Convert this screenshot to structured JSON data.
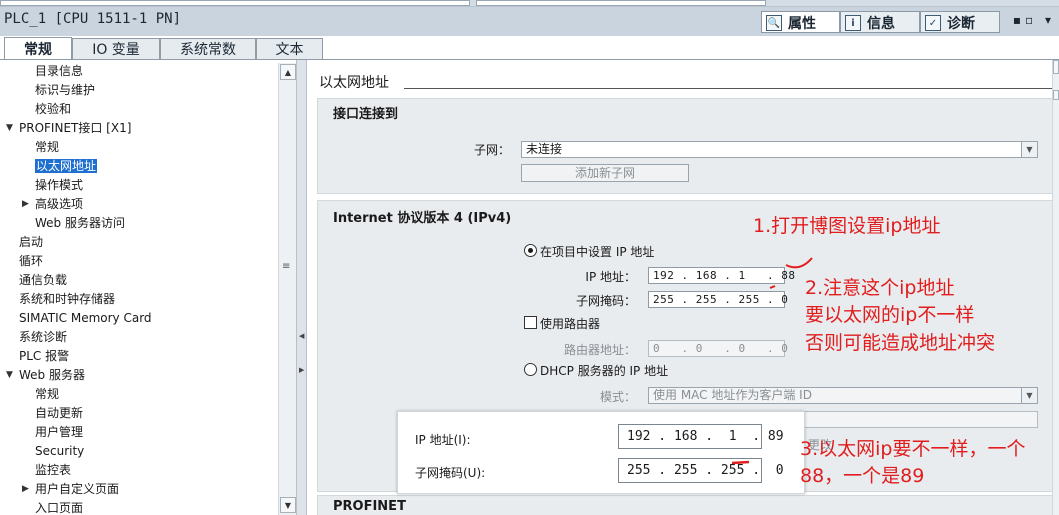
{
  "window": {
    "device_title": "PLC_1 [CPU 1511-1 PN]",
    "pane_tabs": [
      {
        "label": "属性",
        "icon": "properties-icon",
        "active": true
      },
      {
        "label": "信息",
        "icon": "info-icon",
        "active": false
      },
      {
        "label": "诊断",
        "icon": "diagnostics-icon",
        "active": false
      }
    ],
    "window_buttons": "▪▫ ▾"
  },
  "subtabs": [
    {
      "label": "常规",
      "active": true
    },
    {
      "label": "IO 变量",
      "active": false
    },
    {
      "label": "系统常数",
      "active": false
    },
    {
      "label": "文本",
      "active": false
    }
  ],
  "nav": {
    "items": [
      {
        "label": "目录信息",
        "level": 2,
        "arrow": ""
      },
      {
        "label": "标识与维护",
        "level": 2,
        "arrow": ""
      },
      {
        "label": "校验和",
        "level": 2,
        "arrow": ""
      },
      {
        "label": "PROFINET接口 [X1]",
        "level": 1,
        "arrow": "▼"
      },
      {
        "label": "常规",
        "level": 2,
        "arrow": ""
      },
      {
        "label": "以太网地址",
        "level": 2,
        "arrow": "",
        "selected": true
      },
      {
        "label": "操作模式",
        "level": 2,
        "arrow": ""
      },
      {
        "label": "高级选项",
        "level": 2,
        "arrow": "▶"
      },
      {
        "label": "Web 服务器访问",
        "level": 2,
        "arrow": ""
      },
      {
        "label": "启动",
        "level": 1,
        "arrow": ""
      },
      {
        "label": "循环",
        "level": 1,
        "arrow": ""
      },
      {
        "label": "通信负载",
        "level": 1,
        "arrow": ""
      },
      {
        "label": "系统和时钟存储器",
        "level": 1,
        "arrow": ""
      },
      {
        "label": "SIMATIC Memory Card",
        "level": 1,
        "arrow": ""
      },
      {
        "label": "系统诊断",
        "level": 1,
        "arrow": ""
      },
      {
        "label": "PLC 报警",
        "level": 1,
        "arrow": ""
      },
      {
        "label": "Web 服务器",
        "level": 1,
        "arrow": "▼"
      },
      {
        "label": "常规",
        "level": 2,
        "arrow": ""
      },
      {
        "label": "自动更新",
        "level": 2,
        "arrow": ""
      },
      {
        "label": "用户管理",
        "level": 2,
        "arrow": ""
      },
      {
        "label": "Security",
        "level": 2,
        "arrow": ""
      },
      {
        "label": "监控表",
        "level": 2,
        "arrow": ""
      },
      {
        "label": "用户自定义页面",
        "level": 2,
        "arrow": "▶"
      },
      {
        "label": "入口页面",
        "level": 2,
        "arrow": ""
      }
    ]
  },
  "content": {
    "heading": "以太网地址",
    "interface": {
      "title": "接口连接到",
      "subnet_label": "子网：",
      "subnet_value": "未连接",
      "add_subnet_button": "添加新子网"
    },
    "ipv4": {
      "title": "Internet 协议版本 4 (IPv4)",
      "set_in_project_label": "在项目中设置 IP 地址",
      "ip_label": "IP 地址：",
      "ip_value": "192 . 168 . 1   . 88",
      "mask_label": "子网掩码：",
      "mask_value": "255 . 255 . 255 . 0",
      "use_router_label": "使用路由器",
      "router_label": "路由器地址：",
      "router_value": "0   . 0   . 0   . 0",
      "dhcp_label": "DHCP 服务器的 IP 地址",
      "mode_label": "模式：",
      "mode_value": "使用 MAC 地址作为客户端 ID"
    },
    "profinet_title": "PROFINET",
    "partial_text": "更改"
  },
  "overlay": {
    "ip_label": "IP 地址(I):",
    "ip_value": "192 . 168 .  1  . 89",
    "mask_label": "子网掩码(U):",
    "mask_value": "255 . 255 . 255 .  0"
  },
  "annotations": {
    "note1": "1.打开博图设置ip地址",
    "note2_line1": "2.注意这个ip地址",
    "note2_line2": "要以太网的ip不一样",
    "note2_line3": "否则可能造成地址冲突",
    "note3_line1": "3.以太网ip要不一样，一个",
    "note3_line2": "88，一个是89",
    "color": "#e11d1d"
  },
  "colors": {
    "selection": "#1f6fd0",
    "panel_bg": "#e9ecef",
    "titlebar": "#c9d4de"
  }
}
